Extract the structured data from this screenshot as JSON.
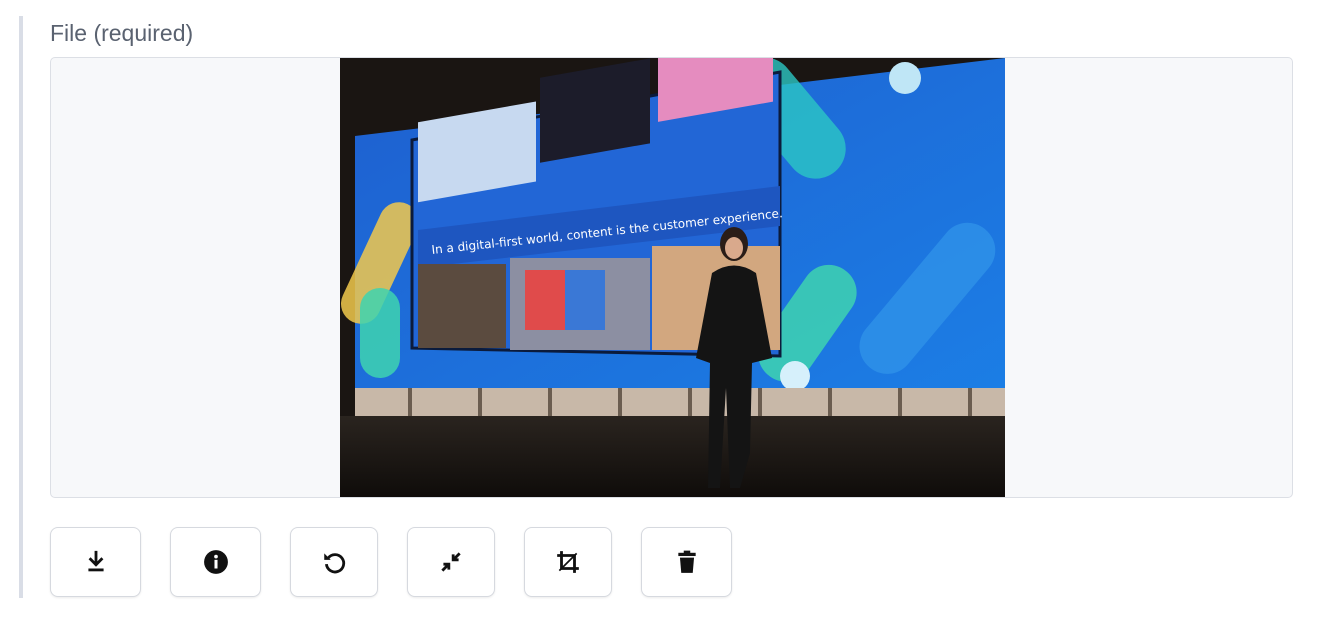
{
  "field": {
    "label": "File (required)"
  },
  "preview": {
    "slide_text": "In a digital-first world, content is the customer experience."
  },
  "toolbar": {
    "buttons": [
      {
        "name": "download-button",
        "icon": "download-icon"
      },
      {
        "name": "info-button",
        "icon": "info-icon"
      },
      {
        "name": "rotate-button",
        "icon": "rotate-icon"
      },
      {
        "name": "shrink-button",
        "icon": "shrink-icon"
      },
      {
        "name": "crop-button",
        "icon": "crop-icon"
      },
      {
        "name": "delete-button",
        "icon": "trash-icon"
      }
    ]
  }
}
